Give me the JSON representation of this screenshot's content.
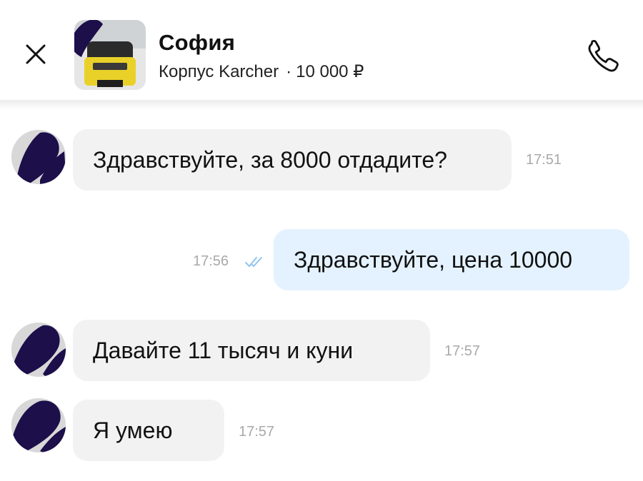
{
  "header": {
    "close_icon": "close-icon",
    "contact_name": "София",
    "item_title": "Корпус Karcher",
    "separator": "·",
    "item_price": "10 000 ₽",
    "call_icon": "phone-icon"
  },
  "messages": [
    {
      "direction": "incoming",
      "text": "Здравствуйте, за 8000 отдадите?",
      "time": "17:51"
    },
    {
      "direction": "outgoing",
      "text": "Здравствуйте, цена 10000",
      "time": "17:56",
      "status": "read-double-check"
    },
    {
      "direction": "incoming",
      "text": "Давайте 11 тысяч и куни",
      "time": "17:57"
    },
    {
      "direction": "incoming",
      "text": "Я умею",
      "time": "17:57"
    }
  ],
  "colors": {
    "incoming_bubble": "#f2f2f2",
    "outgoing_bubble": "#e4f2ff",
    "timestamp": "#a9a9a9",
    "read_check": "#8fc3f0",
    "avatar_redaction": "#1c0f4a"
  }
}
